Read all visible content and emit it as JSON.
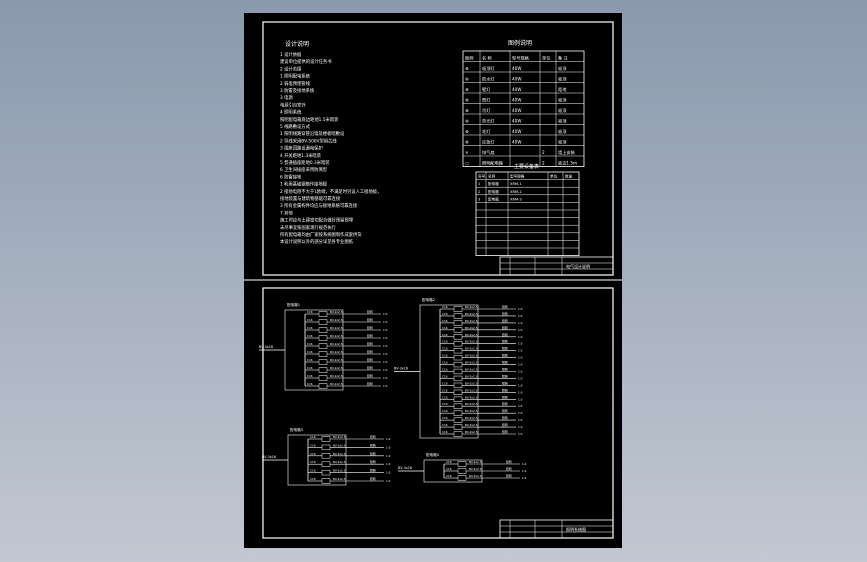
{
  "app": {
    "colors": {
      "background": "#9aa6b8",
      "paper": "#000000",
      "ink": "#ffffff"
    }
  },
  "sheet_top": {
    "notes_title": "设计说明",
    "notes": [
      "1  设计依据",
      "   建设单位提供的设计任务书",
      "2  设计范围",
      "   1  照明配电系统",
      "   2  弱电预埋管线",
      "   3  防雷及接地系统",
      "3  电源",
      "   电源引自室外",
      "4  照明系统",
      "   照明配电箱底边距地1.5米暗装",
      "5  线路敷设方式",
      "   1  照明线路穿管沿墙及楼板暗敷设",
      "   2  导线采用BV-500V型铜芯线",
      "   3  插座回路设漏电保护",
      "   4  开关距地1.3米暗装",
      "   5  普通插座距地0.3米暗装",
      "   6  卫生间插座采用防溅型",
      "6  防雷接地",
      "   1  利用基础钢筋作接地极",
      "   2  接地电阻不大于1欧姆，不满足时另设人工接地极，",
      "      接地装置与建筑物基础可靠连接",
      "   3  所有金属构件均应与接地系统可靠连接",
      "7  其他",
      "   施工时应与土建密切配合做好预留预埋",
      "   未尽事宜按国家现行规范执行",
      "   所有配电箱均由厂家按系统图制作成套供货",
      "   本设计说明以外的部分详见各专业图纸"
    ],
    "legend_title": "图例说明",
    "legend_headers": [
      "图例",
      "名 称",
      "型号规格",
      "单位",
      "备 注"
    ],
    "legend_rows": [
      [
        "⊗",
        "吸顶灯",
        "40W",
        "",
        "吸顶"
      ],
      [
        "⊗",
        "防水灯",
        "40W",
        "",
        "吸顶"
      ],
      [
        "⊗",
        "壁灯",
        "40W",
        "",
        "距地"
      ],
      [
        "⊗",
        "筒灯",
        "40W",
        "",
        "吸顶"
      ],
      [
        "⊗",
        "吊灯",
        "40W",
        "",
        "吸顶"
      ],
      [
        "⊗",
        "荧光灯",
        "40W",
        "",
        "吸顶"
      ],
      [
        "⊗",
        "花灯",
        "40W",
        "",
        "吸顶"
      ],
      [
        "⊗",
        "应急灯",
        "40W",
        "",
        "吸顶"
      ],
      [
        "✕",
        "排气扇",
        "",
        "2",
        "墙上安装"
      ],
      [
        "▭",
        "照明配电箱",
        "",
        "2",
        "底边1.5m"
      ]
    ],
    "material_title": "主要设备表",
    "material_headers": [
      "序号",
      "名称",
      "型号规格",
      "单位",
      "数量"
    ],
    "material_rows": [
      [
        "1",
        "配电箱",
        "XRM-1",
        "",
        ""
      ],
      [
        "2",
        "配电箱",
        "XRM-2",
        "",
        ""
      ],
      [
        "3",
        "配电箱",
        "XRM-3",
        "",
        ""
      ]
    ],
    "title_block": "电气设计说明"
  },
  "sheet_bottom": {
    "title_block": "照明系统图",
    "panels": [
      {
        "label": "配电箱1",
        "incoming": "BV-3x16",
        "breaker_label": "C16",
        "circuit_label": "BV-2x2.5",
        "load_label": "照明",
        "kw": "1.0"
      },
      {
        "label": "配电箱2",
        "incoming": "BV-3x16",
        "breaker_label": "C16",
        "circuit_label": "BV-2x2.5",
        "load_label": "照明",
        "kw": "1.0"
      },
      {
        "label": "配电箱3",
        "incoming": "BV-3x16",
        "breaker_label": "C16",
        "circuit_label": "BV-2x2.5",
        "load_label": "照明",
        "kw": "1.0"
      },
      {
        "label": "配电箱4",
        "incoming": "BV-3x16",
        "breaker_label": "C16",
        "circuit_label": "BV-2x2.5",
        "load_label": "照明",
        "kw": "1.0"
      }
    ]
  }
}
